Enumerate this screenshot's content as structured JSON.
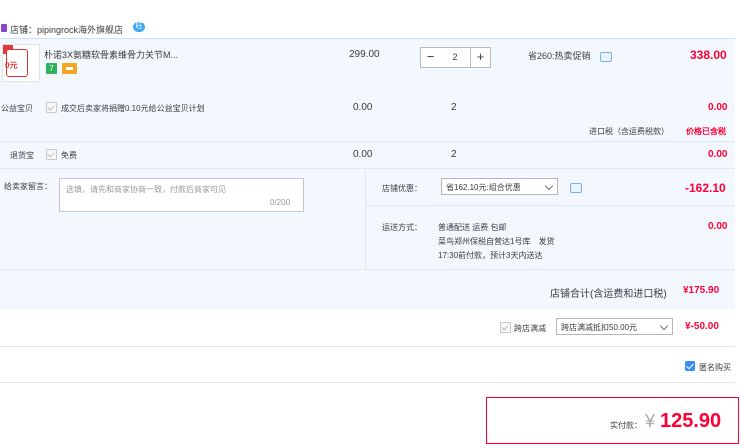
{
  "store": {
    "label": "店铺：pipingrock海外旗舰店",
    "wangwang": "旺"
  },
  "item": {
    "title": "朴诺3X氨糖软骨素维骨力关节M...",
    "badge7": "7",
    "thumb_text": "0元",
    "unit_price": "299.00",
    "quantity": "2",
    "qty_minus": "−",
    "qty_plus": "+",
    "promo": "省260:热卖促销",
    "subtotal": "338.00"
  },
  "charity": {
    "label": "公益宝贝",
    "desc": "成交后卖家将捐赠0.10元给公益宝贝计划",
    "price": "0.00",
    "qty": "2",
    "subtotal": "0.00"
  },
  "import_tax": {
    "label": "进口税（含运费税款）",
    "status": "价格已含税"
  },
  "return_ins": {
    "label": "退货宝",
    "desc": "免费",
    "price": "0.00",
    "qty": "2",
    "subtotal": "0.00"
  },
  "message": {
    "label": "给卖家留言：",
    "placeholder": "选填，请先和商家协商一致，付款后商家可见",
    "count": "0/200"
  },
  "store_discount": {
    "label": "店铺优惠：",
    "selected": "省162.10元:组合优惠",
    "amount": "-162.10"
  },
  "shipping": {
    "label": "运送方式：",
    "line1": "普通配送 运费 包邮",
    "line2": "菜鸟郑州保税自营达1号库　发货",
    "line3": "17:30前付款，预计3天内送达",
    "amount": "0.00"
  },
  "store_total": {
    "label": "店铺合计(含运费和进口税)",
    "amount": "¥175.90"
  },
  "cross_store": {
    "label": "跨店满减",
    "selected": "跨店满减抵扣50.00元",
    "amount": "¥-50.00"
  },
  "anonymous": {
    "label": "匿名购买"
  },
  "pay": {
    "label": "实付款：",
    "currency": "¥",
    "amount": "125.90"
  },
  "colors": {
    "accent_red": "#ff0036",
    "row_bg": "#f3f8ff",
    "checkbox_blue": "#3b8cff"
  }
}
